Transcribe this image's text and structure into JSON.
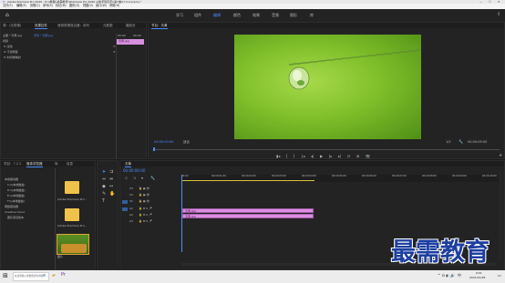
{
  "window": {
    "app_title": "Adobe Premiere Pro 2020 - D:\\\\教程\\\\最需教育\\\\Premiere Pro 2020 从新手到高手\\\\第7章\\\\7.2.2.prproj *",
    "minimize": "—",
    "maximize": "☐",
    "close": "✕"
  },
  "menu": [
    "文件(F)",
    "编辑(E)",
    "剪辑(C)",
    "序列(S)",
    "标记(M)",
    "图形(G)",
    "视图(V)",
    "窗口(W)",
    "帮助(H)"
  ],
  "workspace_tabs": [
    "学习",
    "组件",
    "编辑",
    "颜色",
    "效果",
    "音频",
    "图形",
    "库"
  ],
  "workspace_active": "编辑",
  "left_top_panel": {
    "tabs": [
      "源：(无剪辑)",
      "效果控件",
      "音频剪辑混合器：序列",
      "元数据",
      "播放页"
    ],
    "active_tab": "效果控件",
    "clip_path": "主要 * 天黄.jpg",
    "sequence_path": "序列 * 天黄.jpg",
    "time_start": "00:00",
    "time_end": "00:00",
    "clip_chip": "天黄.jpg",
    "section_video": "视频",
    "effects": [
      "fx 运动",
      "fx 不透明度",
      "fx 时间重映射"
    ]
  },
  "program_monitor": {
    "title": "节目：天黄",
    "timecode_left": "00:00:00:00",
    "fit": "适合",
    "fraction": "1/2",
    "timecode_right": "00:00:05:00",
    "transport": [
      "▮◂",
      "{",
      "}",
      "|◂",
      "◂|",
      "▶",
      "|▸",
      "▸|",
      "⊡",
      "⊞",
      "📷"
    ]
  },
  "project_panel": {
    "tabs": [
      "项目：7.2.2",
      "媒体浏览器",
      "库",
      "信息"
    ],
    "active_tab": "媒体浏览器",
    "tree": [
      "本地驱动器",
      "C:\\\\(本地磁盘)",
      "D:\\\\(本地磁盘)",
      "E:\\\\(本地磁盘)",
      "F:\\\\(本地磁盘)",
      "网络驱动器",
      "Creative Cloud",
      "团队项目版本"
    ],
    "files": [
      {
        "name": "Adobe Premiere Pro..."
      },
      {
        "name": "Adobe Premiere Pro..."
      },
      {
        "name": "图片"
      }
    ]
  },
  "timeline": {
    "title": "天黄",
    "timecode": "00:00:00:00",
    "ruler": [
      "00:00",
      "00:00:01:00",
      "00:00:02:00",
      "00:00:03:00",
      "00:00:04:00",
      "00:00:05:00",
      "00:00:06:00",
      "00:00:07:00",
      "00:00:08:00",
      "00:00:09:00",
      "00:00:10:00"
    ],
    "tracks_video": [
      "V3",
      "V2",
      "V1"
    ],
    "tracks_audio": [
      "A1",
      "A2",
      "A3"
    ],
    "clips": [
      "天黄.jpg",
      "天黄.jpg"
    ]
  },
  "watermark": "最需教育",
  "taskbar": {
    "search": "在这里输入你要搜索的内容",
    "time": "9:01",
    "date": "2021/10/28",
    "lang": "中"
  }
}
